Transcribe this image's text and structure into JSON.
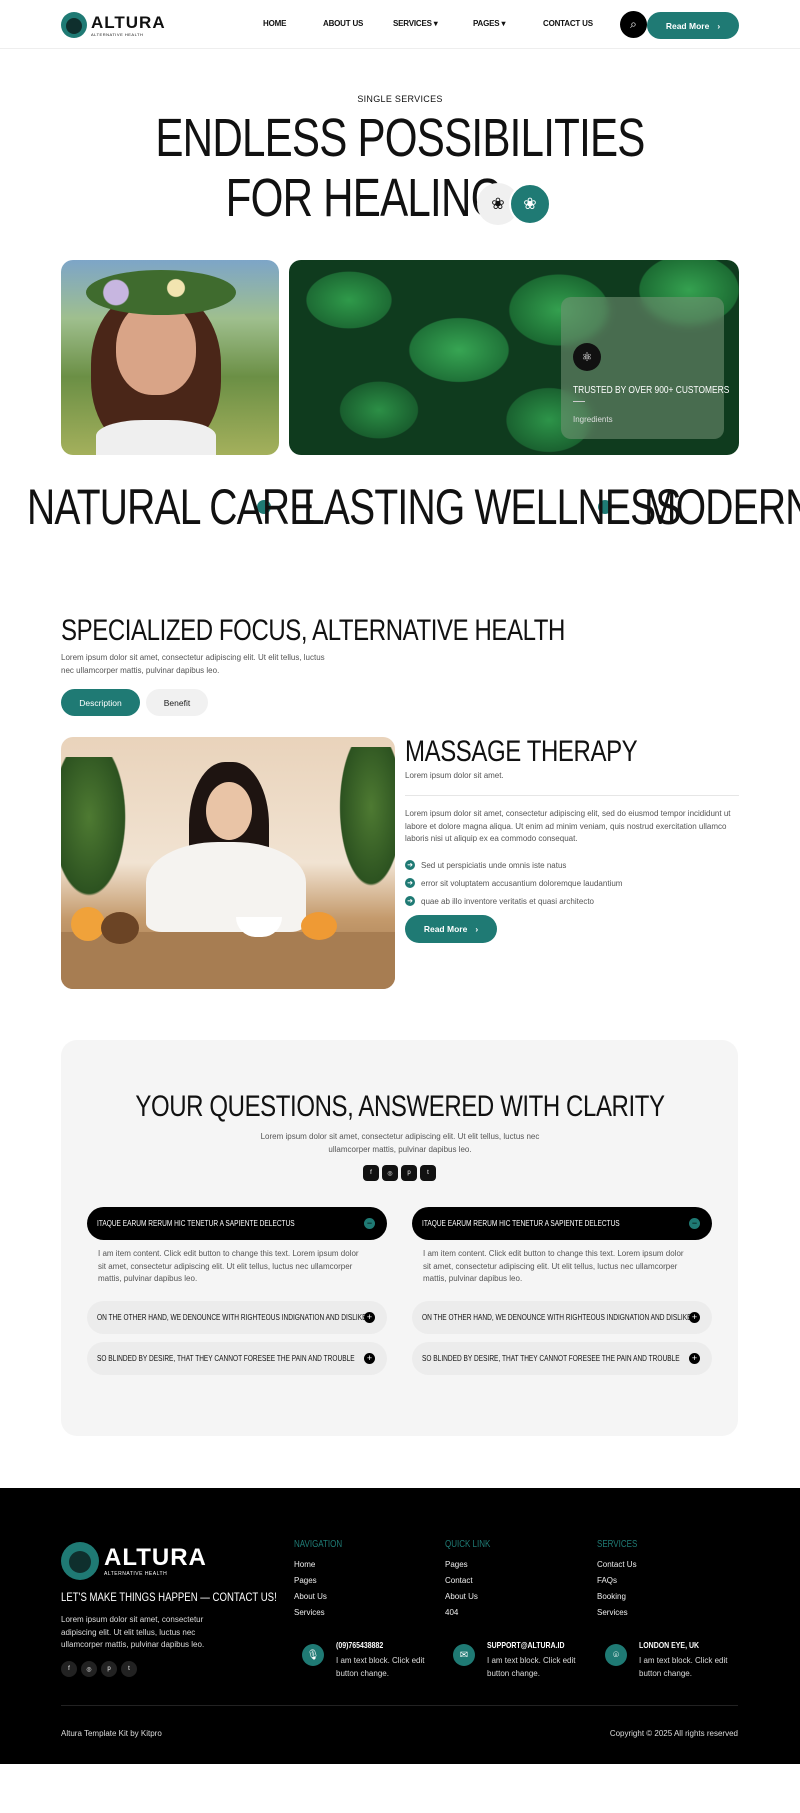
{
  "header": {
    "logo_name": "ALTURA",
    "logo_sub": "ALTERNATIVE HEALTH",
    "nav": [
      "HOME",
      "ABOUT US",
      "SERVICES",
      "PAGES",
      "CONTACT US"
    ],
    "cta": "Read More"
  },
  "hero": {
    "eyebrow": "SINGLE SERVICES",
    "title_line1": "ENDLESS POSSIBILITIES",
    "title_line2": "FOR HEALING",
    "trust_title": "TRUSTED BY OVER 900+ CUSTOMERS",
    "trust_sub": "Ingredients"
  },
  "marquee": [
    "NATURAL CARE",
    "LASTING WELLNESS",
    "MODERN WE"
  ],
  "focus": {
    "title": "SPECIALIZED FOCUS, ALTERNATIVE HEALTH",
    "text": "Lorem ipsum dolor sit amet, consectetur adipiscing elit. Ut elit tellus, luctus nec ullamcorper mattis, pulvinar dapibus leo.",
    "tabs": [
      "Description",
      "Benefit"
    ]
  },
  "therapy": {
    "title": "MASSAGE THERAPY",
    "subtitle": "Lorem ipsum dolor sit amet.",
    "body": "Lorem ipsum dolor sit amet, consectetur adipiscing elit, sed do eiusmod tempor incididunt ut labore et dolore magna aliqua. Ut enim ad minim veniam, quis nostrud exercitation ullamco laboris nisi ut aliquip ex ea commodo consequat.",
    "checks": [
      "Sed ut perspiciatis unde omnis iste natus",
      "error sit voluptatem accusantium doloremque laudantium",
      "quae ab illo inventore veritatis et quasi architecto"
    ],
    "button": "Read More"
  },
  "faq": {
    "title": "YOUR QUESTIONS, ANSWERED WITH CLARITY",
    "text": "Lorem ipsum dolor sit amet, consectetur adipiscing elit. Ut elit tellus, luctus nec ullamcorper mattis, pulvinar dapibus leo.",
    "open_q": "ITAQUE EARUM RERUM HIC TENETUR A SAPIENTE DELECTUS",
    "answer": "I am item content. Click edit button to change this text. Lorem ipsum dolor sit amet, consectetur adipiscing elit. Ut elit tellus, luctus nec ullamcorper mattis, pulvinar dapibus leo.",
    "q2": "ON THE OTHER HAND, WE DENOUNCE WITH RIGHTEOUS INDIGNATION AND DISLIKE",
    "q3": "SO BLINDED BY DESIRE, THAT THEY CANNOT FORESEE THE PAIN AND TROUBLE"
  },
  "footer": {
    "cta": "LET'S MAKE THINGS HAPPEN — CONTACT US!",
    "text": "Lorem ipsum dolor sit amet, consectetur adipiscing elit. Ut elit tellus, luctus nec ullamcorper mattis, pulvinar dapibus leo.",
    "col1": {
      "title": "NAVIGATION",
      "items": [
        "Home",
        "Pages",
        "About Us",
        "Services"
      ]
    },
    "col2": {
      "title": "QUICK LINK",
      "items": [
        "Pages",
        "Contact",
        "About Us",
        "404"
      ]
    },
    "col3": {
      "title": "SERVICES",
      "items": [
        "Contact Us",
        "FAQs",
        "Booking",
        "Services"
      ]
    },
    "contacts": [
      {
        "title": "(09)765438882",
        "desc": "I am text block. Click edit button  change."
      },
      {
        "title": "SUPPORT@ALTURA.ID",
        "desc": "I am text block. Click edit button  change."
      },
      {
        "title": "LONDON EYE, UK",
        "desc": "I am text block. Click edit button  change."
      }
    ],
    "bottom_left": "Altura Template Kit by Kitpro",
    "bottom_right": "Copyright © 2025 All rights reserved"
  },
  "colors": {
    "accent": "#1f7a74",
    "dark": "#000000",
    "light_bg": "#f5f5f5"
  }
}
